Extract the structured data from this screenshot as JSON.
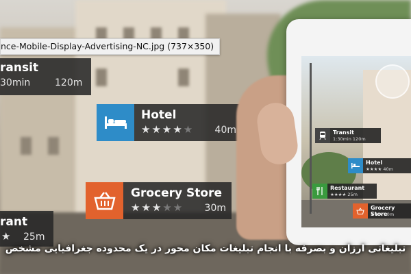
{
  "tooltip": {
    "filename": "nce-Mobile-Display-Advertising-NC.jpg (737×350)"
  },
  "ar_cards": {
    "transit": {
      "title": "ransit",
      "time": "30min",
      "distance": "120m",
      "icon": "train-icon"
    },
    "hotel": {
      "title": "Hotel",
      "rating": 4,
      "distance": "40m",
      "icon": "bed-icon",
      "color": "#2e8cc8"
    },
    "grocery": {
      "title": "Grocery Store",
      "rating": 3,
      "distance": "30m",
      "icon": "basket-icon",
      "color": "#e2622d"
    },
    "restaurant": {
      "title": "rant",
      "distance": "25m"
    }
  },
  "phone_cards": {
    "transit": {
      "title": "Transit",
      "sub": "1:30min 120m",
      "icon": "train-icon"
    },
    "hotel": {
      "title": "Hotel",
      "sub": "★★★★ 40m",
      "icon": "bed-icon"
    },
    "restaurant": {
      "title": "Restaurant",
      "sub": "★★★★ 25m",
      "icon": "fork-knife-icon"
    },
    "grocery": {
      "title": "Grocery Store",
      "sub": "★★★ 30m",
      "icon": "basket-icon"
    }
  },
  "caption": "تبلیغاتی ارزان و بصرفه با انجام تبلیغات مکان محور در یک محدوده جغرافیایی مشخص"
}
